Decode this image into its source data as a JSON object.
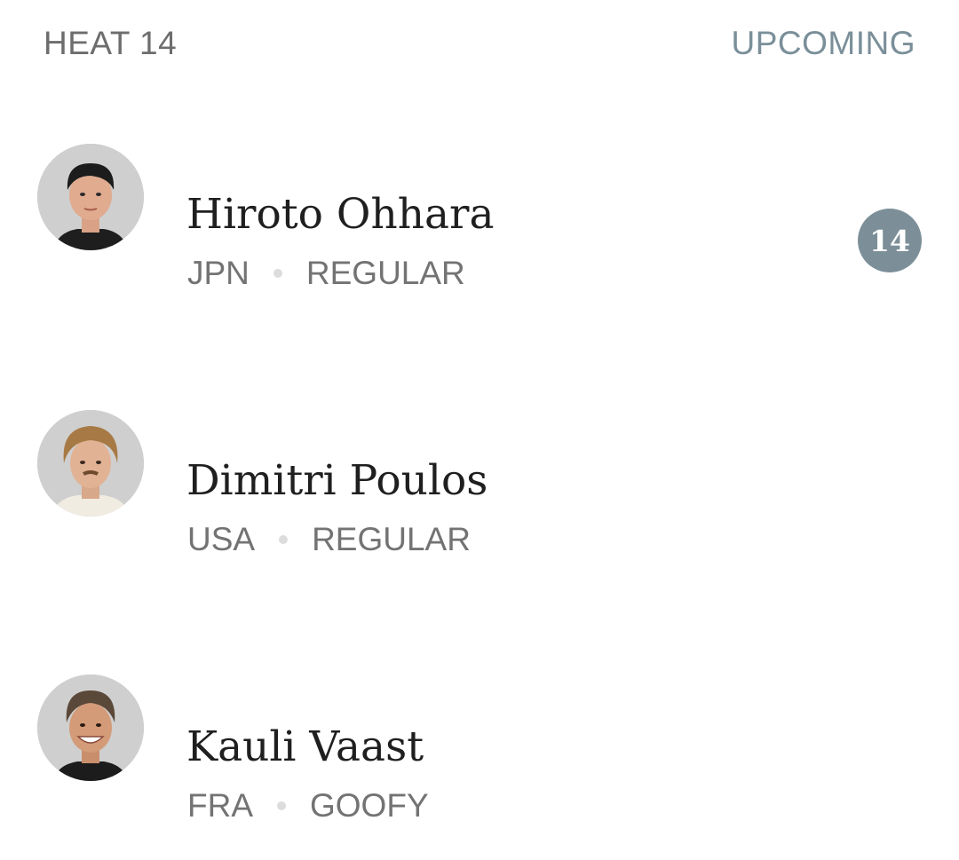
{
  "heat": {
    "label": "HEAT 14",
    "status": "UPCOMING"
  },
  "surfers": [
    {
      "name": "Hiroto Ohhara",
      "country": "JPN",
      "stance": "REGULAR",
      "seed": "14",
      "avatar_icon": "surfer-headshot-icon"
    },
    {
      "name": "Dimitri Poulos",
      "country": "USA",
      "stance": "REGULAR",
      "avatar_icon": "surfer-headshot-icon"
    },
    {
      "name": "Kauli Vaast",
      "country": "FRA",
      "stance": "GOOFY",
      "avatar_icon": "surfer-headshot-icon"
    }
  ],
  "colors": {
    "accent": "#7c8f99",
    "avatar_bg": "#cfcfcf",
    "text_primary": "#1f1f1f",
    "text_secondary": "#737373"
  }
}
